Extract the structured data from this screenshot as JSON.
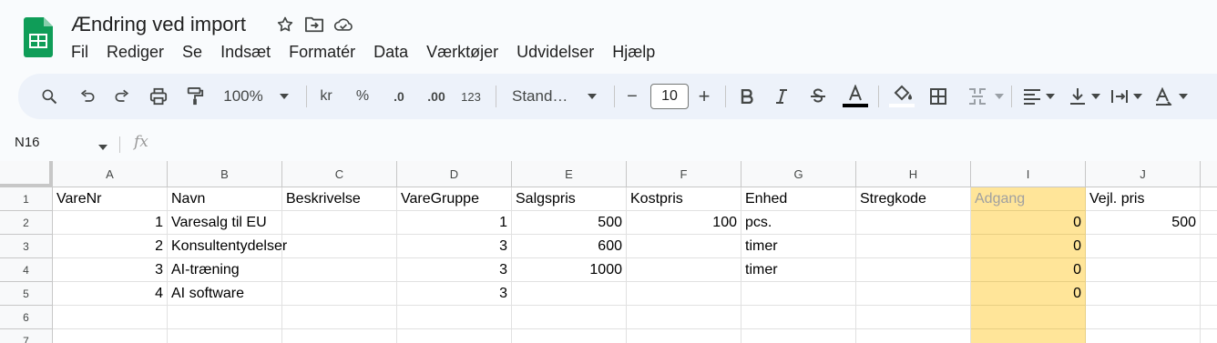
{
  "app": {
    "title": "Ændring ved import",
    "menu": [
      "Fil",
      "Rediger",
      "Se",
      "Indsæt",
      "Formatér",
      "Data",
      "Værktøjer",
      "Udvidelser",
      "Hjælp"
    ]
  },
  "toolbar": {
    "zoom": "100%",
    "currency": "kr",
    "percent": "%",
    "dec_decrease": ".0",
    "dec_increase": ".00",
    "number_format": "123",
    "font": "Stand…",
    "font_size": "10",
    "minus": "−",
    "plus": "+"
  },
  "formula_bar": {
    "cell_ref": "N16",
    "fx": "fx"
  },
  "sheet": {
    "columns": [
      "A",
      "B",
      "C",
      "D",
      "E",
      "F",
      "G",
      "H",
      "I",
      "J"
    ],
    "row_numbers": [
      "1",
      "2",
      "3",
      "4",
      "5",
      "6",
      "7"
    ],
    "rows": [
      [
        "VareNr",
        "Navn",
        "Beskrivelse",
        "VareGruppe",
        "Salgspris",
        "Kostpris",
        "Enhed",
        "Stregkode",
        "Adgang",
        "Vejl. pris"
      ],
      [
        "1",
        "Varesalg til EU",
        "",
        "1",
        "500",
        "100",
        "pcs.",
        "",
        "0",
        "500"
      ],
      [
        "2",
        "Konsultentydelser",
        "",
        "3",
        "600",
        "",
        "timer",
        "",
        "0",
        ""
      ],
      [
        "3",
        "AI-træning",
        "",
        "3",
        "1000",
        "",
        "timer",
        "",
        "0",
        ""
      ],
      [
        "4",
        "AI software",
        "",
        "3",
        "",
        "",
        "",
        "",
        "0",
        ""
      ],
      [
        "",
        "",
        "",
        "",
        "",
        "",
        "",
        "",
        "",
        ""
      ],
      [
        "",
        "",
        "",
        "",
        "",
        "",
        "",
        "",
        "",
        ""
      ]
    ],
    "highlight_color": "#ffe599"
  },
  "colors": {
    "toolbar_bg": "#edf2fa",
    "sheets_green": "#0f9d58"
  }
}
